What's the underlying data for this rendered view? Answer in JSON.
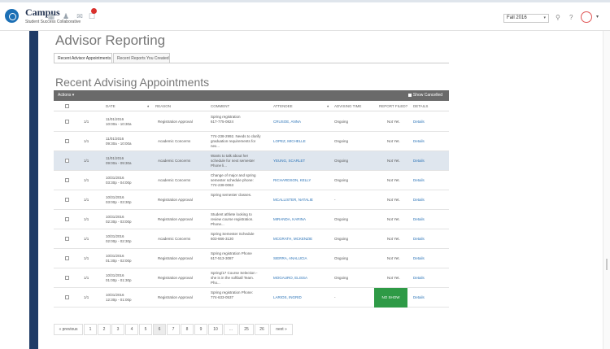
{
  "app": {
    "title": "Campus",
    "subtitle": "Student Success Collaborative"
  },
  "header": {
    "term": "Fall 2016",
    "icons": [
      "calendar-icon",
      "people-icon",
      "message-icon",
      "notification-icon"
    ],
    "accent_color": "#1b6fb5"
  },
  "page": {
    "title": "Advisor Reporting",
    "tabs": [
      "Recent Advisor Appointments",
      "Recent Reports You Created"
    ],
    "section_title": "Recent Advising Appointments"
  },
  "table": {
    "actions_label": "Actions ▾",
    "show_cancelled_label": "Show Cancelled",
    "columns": {
      "date": "DATE",
      "reason": "REASON",
      "comment": "COMMENT",
      "attendee": "ATTENDEE",
      "advising_time": "ADVISING TIME",
      "report_filed": "REPORT FILED?",
      "details": "DETAILS"
    },
    "rows": [
      {
        "count": "1/1",
        "date": "11/01/2016",
        "time": "10:00a - 10:30a",
        "reason": "Registration Approval",
        "comment1": "Spring registration",
        "comment2": "617-775-0824",
        "comment3": "",
        "attendee": "CRUSOE, ANNA",
        "advising_time": "Ongoing",
        "report_filed": "Not Yet.",
        "details": "Details"
      },
      {
        "count": "1/1",
        "date": "11/01/2016",
        "time": "09:30a - 10:00a",
        "reason": "Academic Concerns",
        "comment1": "774-238-2992. Needs to clarify",
        "comment2": "graduation requirements for",
        "comment3": "nex...",
        "attendee": "LOPEZ, MICHELLE",
        "advising_time": "Ongoing",
        "report_filed": "Not Yet.",
        "details": "Details"
      },
      {
        "count": "1/1",
        "date": "11/01/2016",
        "time": "09:00a - 09:30a",
        "reason": "Academic Concerns",
        "comment1": "Wants to talk about her",
        "comment2": "schedule for next semester",
        "comment3": "Phone li...",
        "attendee": "YEUNG, SCARLET",
        "advising_time": "Ongoing",
        "report_filed": "Not Yet.",
        "details": "Details"
      },
      {
        "count": "1/1",
        "date": "10/31/2016",
        "time": "03:30p - 04:00p",
        "reason": "Academic Concerns",
        "comment1": "Change of major and spring",
        "comment2": "semester schedule phone:",
        "comment3": "774-238-0063",
        "attendee": "RICHARDSON, KELLY",
        "advising_time": "Ongoing",
        "report_filed": "Not Yet.",
        "details": "Details"
      },
      {
        "count": "1/1",
        "date": "10/31/2016",
        "time": "03:00p - 03:30p",
        "reason": "Registration Approval",
        "comment1": "Spring semester classes.",
        "comment2": "",
        "comment3": "",
        "attendee": "MCALLISTER, NATALIE",
        "advising_time": "-",
        "report_filed": "Not Yet.",
        "details": "Details"
      },
      {
        "count": "1/1",
        "date": "10/31/2016",
        "time": "02:30p - 03:00p",
        "reason": "Registration Approval",
        "comment1": "Student athlete looking to",
        "comment2": "review course registration.",
        "comment3": "Phone...",
        "attendee": "MIRANDA, KARINA",
        "advising_time": "Ongoing",
        "report_filed": "Not Yet.",
        "details": "Details"
      },
      {
        "count": "1/1",
        "date": "10/31/2016",
        "time": "02:00p - 02:30p",
        "reason": "Academic Concerns",
        "comment1": "Spring Semester Schedule",
        "comment2": "603-666-3130",
        "comment3": "",
        "attendee": "MCGRATH, MCKENZIE",
        "advising_time": "Ongoing",
        "report_filed": "Not Yet.",
        "details": "Details"
      },
      {
        "count": "1/1",
        "date": "10/31/2016",
        "time": "01:30p - 02:00p",
        "reason": "Registration Approval",
        "comment1": "Spring registration Phone",
        "comment2": "617-513-3087",
        "comment3": "",
        "attendee": "SIERRA, ANALUCIA",
        "advising_time": "Ongoing",
        "report_filed": "Not Yet.",
        "details": "Details"
      },
      {
        "count": "1/1",
        "date": "10/31/2016",
        "time": "01:00p - 01:30p",
        "reason": "Registration Approval",
        "comment1": "Spring/17 Course Selection -",
        "comment2": "she is in the softball Team.",
        "comment3": "Pho...",
        "attendee": "MOGAURO, ELISSA",
        "advising_time": "Ongoing",
        "report_filed": "Not Yet.",
        "details": "Details"
      },
      {
        "count": "1/1",
        "date": "10/31/2016",
        "time": "12:30p - 01:00p",
        "reason": "Registration Approval",
        "comment1": "Spring registration Phone:",
        "comment2": "774-633-0537",
        "comment3": "",
        "attendee": "LARIOS, INGRID",
        "advising_time": "-",
        "report_filed": "NO SHOW",
        "details": "Details"
      }
    ],
    "highlight_row": 2,
    "noshow_color": "#2e9a46"
  },
  "pagination": [
    "« previous",
    "1",
    "2",
    "3",
    "4",
    "5",
    "6",
    "7",
    "8",
    "9",
    "10",
    "...",
    "25",
    "26",
    "next »"
  ],
  "pagination_active": "6"
}
